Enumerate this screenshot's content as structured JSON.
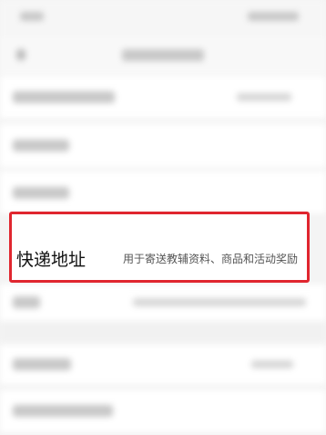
{
  "highlighted_row": {
    "label": "快递地址",
    "description": "用于寄送教辅资料、商品和活动奖励"
  },
  "colors": {
    "highlight_border": "#e0262f",
    "page_background": "#f4f4f4"
  }
}
